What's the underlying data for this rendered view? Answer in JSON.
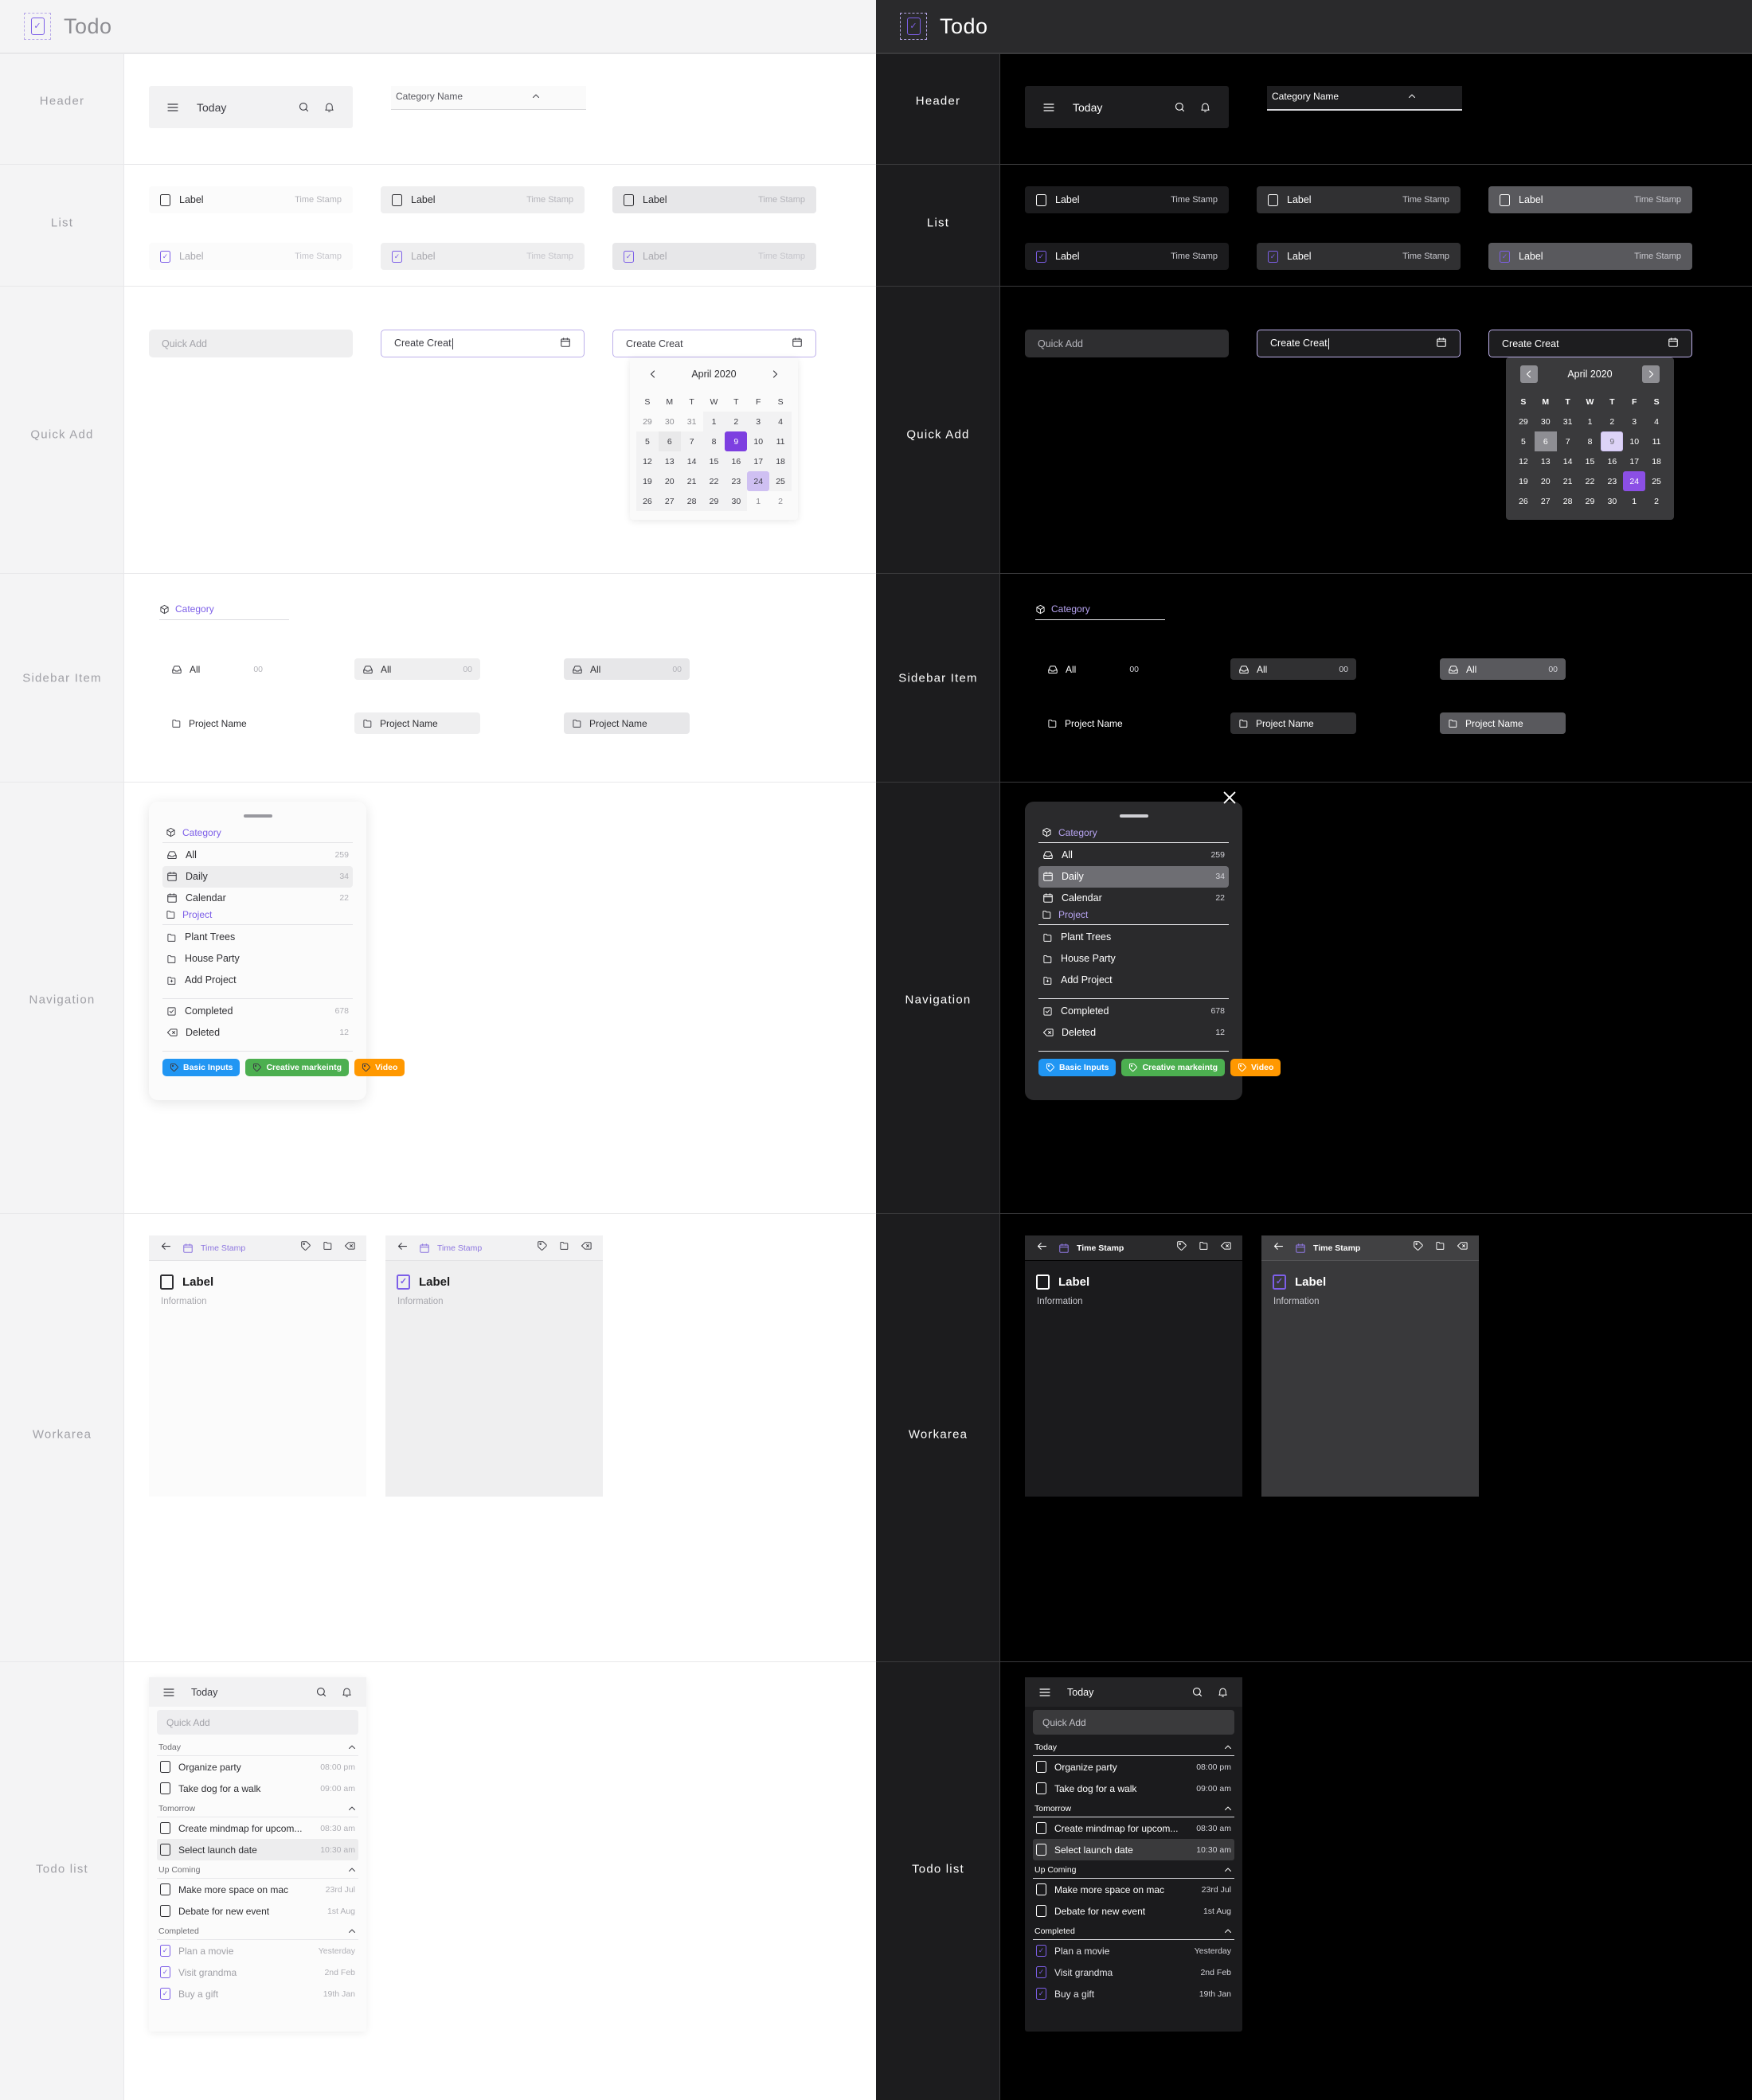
{
  "app": {
    "title": "Todo",
    "logo_icon": "todo-checkbox-logo-icon"
  },
  "rail_labels": [
    "Header",
    "List",
    "Quick Add",
    "Sidebar Item",
    "Navigation",
    "Workarea",
    "Todo list"
  ],
  "header": {
    "menu_icon": "hamburger-menu-icon",
    "title": "Today",
    "search_icon": "search-icon",
    "bell_icon": "bell-icon",
    "category_select": {
      "label": "Category Name",
      "chevron_icon": "chevron-up-icon"
    }
  },
  "list": {
    "label": "Label",
    "timestamp": "Time Stamp",
    "states": [
      "default",
      "hover",
      "pressed"
    ]
  },
  "quick_add": {
    "placeholder": "Quick Add",
    "typed_value": "Create Creat",
    "calendar_icon": "calendar-icon"
  },
  "calendar": {
    "month": "April 2020",
    "prev_icon": "chevron-left-icon",
    "next_icon": "chevron-right-icon",
    "dow": [
      "S",
      "M",
      "T",
      "W",
      "T",
      "F",
      "S"
    ],
    "weeks": [
      [
        {
          "d": "29",
          "t": "muted"
        },
        {
          "d": "30",
          "t": "muted"
        },
        {
          "d": "31",
          "t": "muted"
        },
        {
          "d": "1",
          "t": "shade"
        },
        {
          "d": "2",
          "t": "shade"
        },
        {
          "d": "3",
          "t": "shade"
        },
        {
          "d": "4",
          "t": "shade"
        }
      ],
      [
        {
          "d": "5",
          "t": "shade"
        },
        {
          "d": "6",
          "t": "hover"
        },
        {
          "d": "7",
          "t": "shade"
        },
        {
          "d": "8",
          "t": "shade"
        },
        {
          "d": "9",
          "t": "sel"
        },
        {
          "d": "10",
          "t": "shade"
        },
        {
          "d": "11",
          "t": "shade"
        }
      ],
      [
        {
          "d": "12",
          "t": "shade"
        },
        {
          "d": "13",
          "t": "shade"
        },
        {
          "d": "14",
          "t": "shade"
        },
        {
          "d": "15",
          "t": "shade"
        },
        {
          "d": "16",
          "t": "shade"
        },
        {
          "d": "17",
          "t": "shade"
        },
        {
          "d": "18",
          "t": "shade"
        }
      ],
      [
        {
          "d": "19",
          "t": "shade"
        },
        {
          "d": "20",
          "t": "shade"
        },
        {
          "d": "21",
          "t": "shade"
        },
        {
          "d": "22",
          "t": "shade"
        },
        {
          "d": "23",
          "t": "shade"
        },
        {
          "d": "24",
          "t": "range"
        },
        {
          "d": "25",
          "t": "shade"
        }
      ],
      [
        {
          "d": "26",
          "t": "shade"
        },
        {
          "d": "27",
          "t": "shade"
        },
        {
          "d": "28",
          "t": "shade"
        },
        {
          "d": "29",
          "t": "shade"
        },
        {
          "d": "30",
          "t": "shade"
        },
        {
          "d": "1",
          "t": "muted"
        },
        {
          "d": "2",
          "t": "muted"
        }
      ]
    ],
    "selected_day": "9",
    "range_day": "24",
    "hover_day": "6"
  },
  "sidebar_item": {
    "category_label": "Category",
    "category_icon": "cube-icon",
    "all_label": "All",
    "all_count": "00",
    "all_icon": "inbox-icon",
    "project_label": "Project Name",
    "project_icon": "folder-icon"
  },
  "navigation": {
    "close_icon": "close-icon",
    "grabber": "drag-handle",
    "category": {
      "label": "Category",
      "icon": "cube-icon"
    },
    "category_items": [
      {
        "label": "All",
        "count": "259",
        "icon": "inbox-icon",
        "active": false
      },
      {
        "label": "Daily",
        "count": "34",
        "icon": "calendar-icon",
        "active": true
      },
      {
        "label": "Calendar",
        "count": "22",
        "icon": "calendar-icon",
        "active": false
      }
    ],
    "project": {
      "label": "Project",
      "icon": "folder-icon"
    },
    "project_items": [
      {
        "label": "Plant Trees",
        "count": "",
        "icon": "folder-icon",
        "active": false
      },
      {
        "label": "House Party",
        "count": "",
        "icon": "folder-icon",
        "active": false
      },
      {
        "label": "Add Project",
        "count": "",
        "icon": "folder-plus-icon",
        "active": false
      }
    ],
    "status_items": [
      {
        "label": "Completed",
        "count": "678",
        "icon": "check-square-icon",
        "active": false
      },
      {
        "label": "Deleted",
        "count": "12",
        "icon": "delete-back-icon",
        "active": false
      }
    ],
    "tags": [
      {
        "label": "Basic Inputs",
        "color": "#2196f3",
        "icon": "tag-icon"
      },
      {
        "label": "Creative markeintg",
        "color": "#4caf50",
        "icon": "tag-icon"
      },
      {
        "label": "Video",
        "color": "#ff9800",
        "icon": "tag-icon"
      }
    ]
  },
  "workarea": {
    "back_icon": "arrow-left-icon",
    "calendar_icon": "calendar-icon",
    "timestamp": "Time Stamp",
    "tag_icon": "tag-icon",
    "folder_icon": "folder-icon",
    "delete_icon": "delete-back-icon",
    "label": "Label",
    "information": "Information"
  },
  "todo_list": {
    "menu_icon": "hamburger-menu-icon",
    "title": "Today",
    "search_icon": "search-icon",
    "bell_icon": "bell-icon",
    "quick_add_placeholder": "Quick Add",
    "collapse_icon": "chevron-up-icon",
    "groups": [
      {
        "name": "Today",
        "items": [
          {
            "label": "Organize party",
            "time": "08:00 pm",
            "checked": false,
            "highlight": false
          },
          {
            "label": "Take dog for a walk",
            "time": "09:00 am",
            "checked": false,
            "highlight": false
          }
        ]
      },
      {
        "name": "Tomorrow",
        "items": [
          {
            "label": "Create mindmap for upcom...",
            "time": "08:30 am",
            "checked": false,
            "highlight": false
          },
          {
            "label": "Select launch date",
            "time": "10:30 am",
            "checked": false,
            "highlight": true
          }
        ]
      },
      {
        "name": "Up Coming",
        "items": [
          {
            "label": "Make more space on mac",
            "time": "23rd Jul",
            "checked": false,
            "highlight": false
          },
          {
            "label": "Debate for new event",
            "time": "1st Aug",
            "checked": false,
            "highlight": false
          }
        ]
      },
      {
        "name": "Completed",
        "items": [
          {
            "label": "Plan a movie",
            "time": "Yesterday",
            "checked": true,
            "highlight": false
          },
          {
            "label": "Visit grandma",
            "time": "2nd Feb",
            "checked": true,
            "highlight": false
          },
          {
            "label": "Buy a gift",
            "time": "19th Jan",
            "checked": true,
            "highlight": false
          }
        ]
      }
    ]
  },
  "colors": {
    "accent_purple": "#7d5fe8",
    "selected_purple": "#7d3fe0",
    "range_purple": "#cfc0f2",
    "light_bg": "#ffffff",
    "light_rail": "#f4f4f5",
    "dark_bg": "#000000",
    "dark_rail": "#1c1c1e",
    "dark_card": "#2a2a2c"
  }
}
